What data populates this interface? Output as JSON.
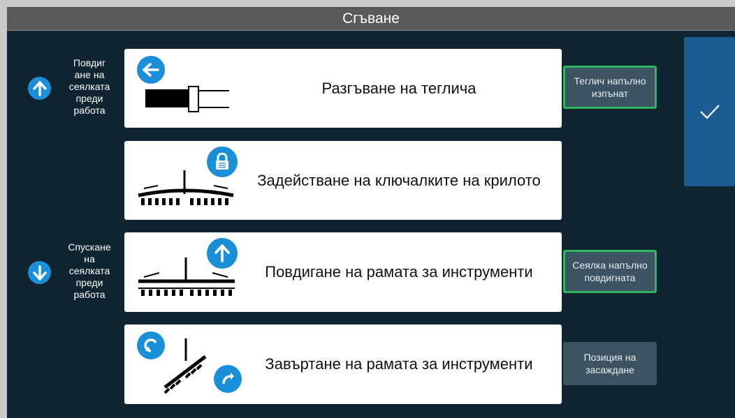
{
  "header": {
    "title": "Сгъване"
  },
  "side": {
    "raise": {
      "label": "Повдиг ане на сеялката преди работа",
      "lines": [
        "Повдиг",
        "ане на",
        "сеялката",
        "преди",
        "работа"
      ]
    },
    "lower": {
      "label": "Спускане на сеялката преди работа",
      "lines": [
        "Спускане",
        "на",
        "сеялката",
        "преди",
        "работа"
      ]
    }
  },
  "steps": [
    {
      "title": "Разгъване на теглича",
      "icon": "arrow-left-icon"
    },
    {
      "title": "Задействане на ключалките на крилото",
      "icon": "lock-icon"
    },
    {
      "title": "Повдигане на рамата за инструменти",
      "icon": "arrow-up-icon"
    },
    {
      "title": "Завъртане на рамата за инструменти",
      "icon": "rotate-icon"
    }
  ],
  "status": {
    "hitch": {
      "lines": [
        "Теглич напълно",
        "изпънат"
      ],
      "active": true
    },
    "planter": {
      "lines": [
        "Сеялка напълно",
        "повдигната"
      ],
      "active": true
    },
    "position": {
      "lines": [
        "Позиция на",
        "засаждане"
      ],
      "active": false
    }
  },
  "confirm": {
    "icon": "checkmark-icon"
  },
  "colors": {
    "background": "#0f2430",
    "accent_blue": "#1a8fd8",
    "status_active": "#2fb65f",
    "confirm_bg": "#1c5c92"
  }
}
